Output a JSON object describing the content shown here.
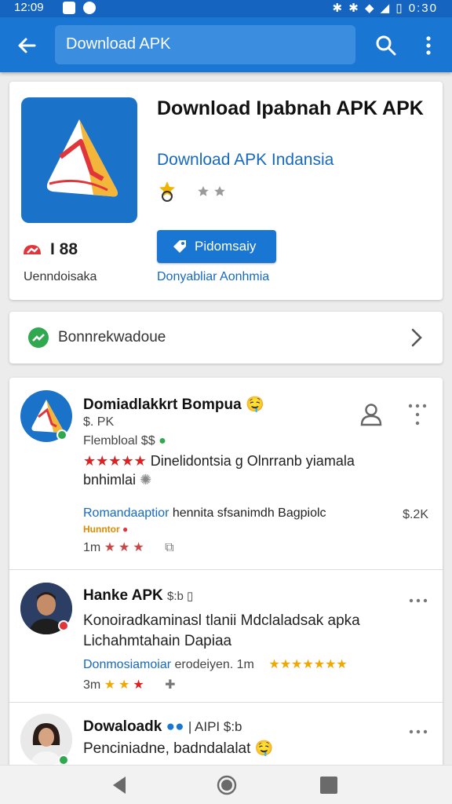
{
  "status_bar": {
    "time": "12:09",
    "right_text": "✱ ✱ ◆ ◢ ▯ 0:30"
  },
  "app_bar": {
    "search_value": "Download APK"
  },
  "app": {
    "title": "Download Ipabnah APK APK",
    "developer": "Download APK Indansia",
    "rating_number": "I 88",
    "rating_caption": "Uenndoisaka",
    "install_label": "Pidomsaiy",
    "install_sub": "Donyabliar Aonhmia",
    "colors": {
      "accent": "#1976d2",
      "link": "#1669c3",
      "icon_bg": "#1a73c9"
    }
  },
  "similar": {
    "label": "Bonnrekwadoue"
  },
  "reviews": [
    {
      "name": "Domiadlakkrt Bompua",
      "name_emoji": "🤤",
      "sub": "$. PK",
      "meta": "Flembloal $$",
      "stars": "★★★★★",
      "text1": "Dinelidontsia g Olnrranb yiamala",
      "text2": "bnhimlai",
      "link": "Romandaaptior",
      "link_rest": " hennita sfsanimdh Bagpiolc",
      "price": "$.2K",
      "highlight": "Hunntor",
      "time": "1m",
      "small_stars": "★★★"
    },
    {
      "name": "Hanke APK",
      "name_suffix": "$:b ▯",
      "text1": "Konoiradkaminasl tlanii Mdclaladsak apka",
      "text2": "Lichahmtahain Dapiaa",
      "meta_link": "Donmosiamoiar",
      "meta_rest": " erodeiyen. 1m",
      "meta_stars": "★★★★★★★",
      "time": "3m",
      "small_stars": "★★★"
    },
    {
      "name": "Dowaloadk",
      "name_suffix": "| AIPI $:b",
      "text1": "Penciniadne, badndalalat",
      "text1_emoji": "🤤"
    }
  ]
}
